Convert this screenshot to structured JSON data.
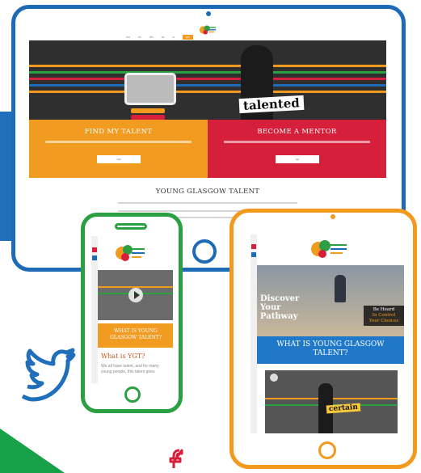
{
  "colors": {
    "desktop_frame": "#1d6bb6",
    "phone_frame": "#2aa043",
    "tablet_frame": "#f39a1e",
    "orange_panel": "#f29b21",
    "red_panel": "#d61f3b",
    "blue_band": "#1f6fba"
  },
  "desktop": {
    "hero_word": "talented",
    "left_panel": {
      "title": "FIND MY TALENT"
    },
    "right_panel": {
      "title": "BECOME A MENTOR"
    },
    "section_title": "YOUNG GLASGOW TALENT"
  },
  "phone": {
    "banner": "WHAT IS YOUNG GLASGOW TALENT?",
    "heading": "What is YGT?",
    "body": "We all have talent, and for many young people, this talent goes"
  },
  "tablet": {
    "hero_heading": "Discover Your Pathway",
    "tagline_lines": [
      "Be Heard",
      "In Control",
      "Your Choices"
    ],
    "banner": "WHAT IS YOUNG GLASGOW TALENT?",
    "video_word": "certain"
  },
  "icons": [
    "twitter-icon",
    "facebook-icon",
    "play-icon"
  ]
}
